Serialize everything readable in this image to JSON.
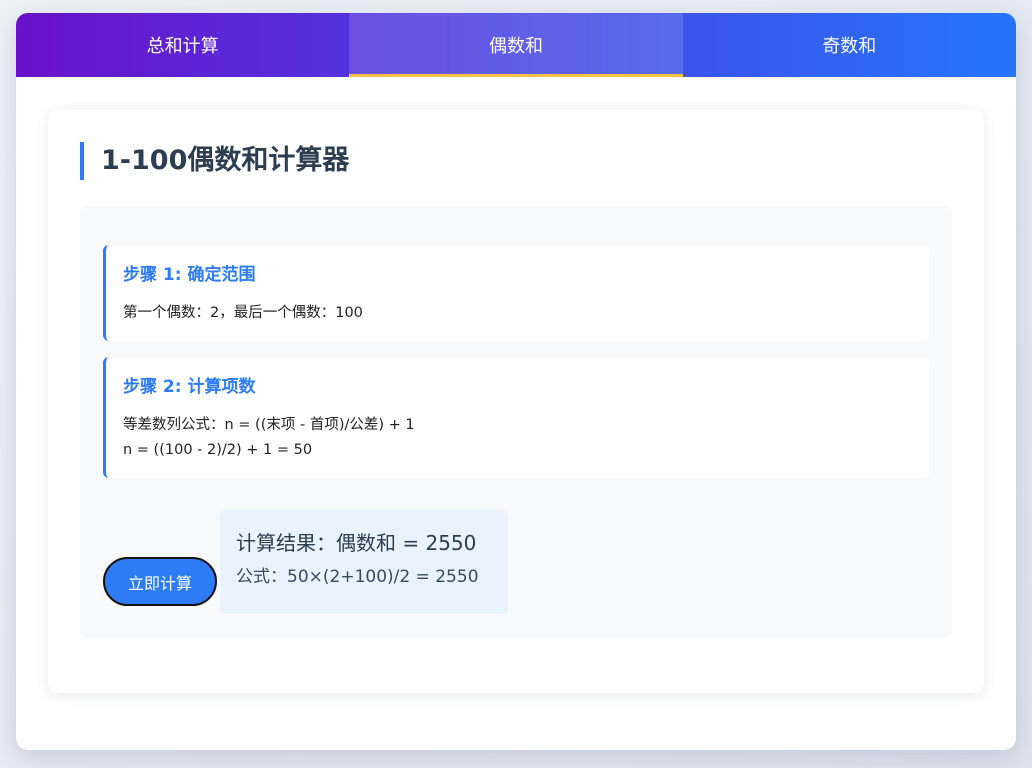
{
  "tabs": [
    {
      "label": "总和计算",
      "active": false
    },
    {
      "label": "偶数和",
      "active": true
    },
    {
      "label": "奇数和",
      "active": false
    }
  ],
  "card": {
    "title": "1-100偶数和计算器"
  },
  "steps": [
    {
      "title": "步骤 1: 确定范围",
      "lines": [
        "第一个偶数：2，最后一个偶数：100"
      ]
    },
    {
      "title": "步骤 2: 计算项数",
      "lines": [
        "等差数列公式：n = ((末项 - 首项)/公差) + 1",
        "n = ((100 - 2)/2) + 1 = 50"
      ]
    }
  ],
  "button": {
    "label": "立即计算"
  },
  "result": {
    "main": "计算结果：偶数和 = 2550",
    "formula": "公式：50×(2+100)/2 = 2550"
  },
  "colors": {
    "gradient_start": "#6a11cb",
    "gradient_end": "#2575fc",
    "accent": "#2d7cf6",
    "active_underline": "#f6c344",
    "result_bg": "#e8f3fe"
  }
}
